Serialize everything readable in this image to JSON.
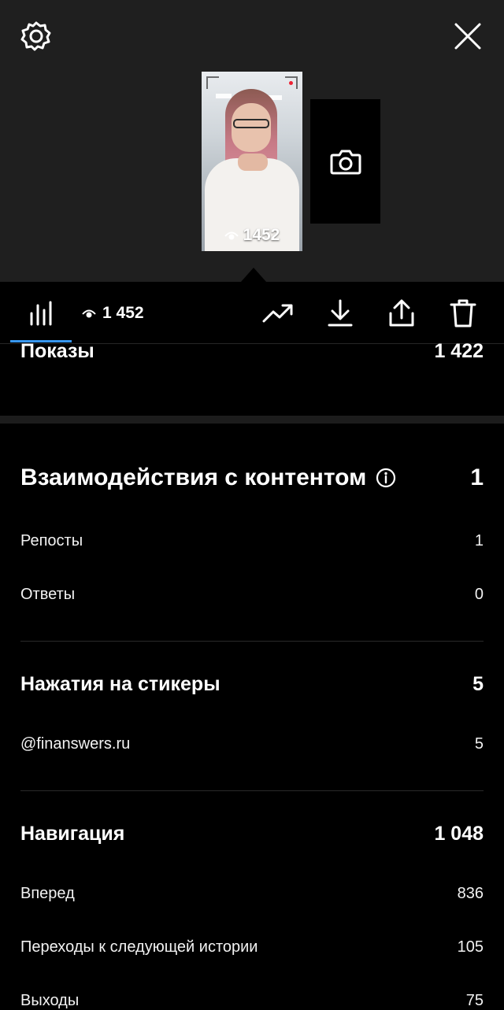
{
  "header": {
    "settings_icon": "settings-outline-icon",
    "close_icon": "close-x-icon"
  },
  "preview": {
    "views_overlay": "1452",
    "camera_icon": "camera-icon"
  },
  "toolbar": {
    "views": "1 452",
    "accent_color": "#3797f0",
    "icons": [
      "bar-chart-icon",
      "eye-icon",
      "trending-up-icon",
      "download-icon",
      "share-icon",
      "trash-icon"
    ]
  },
  "stats": {
    "impressions": {
      "label": "Показы",
      "value": "1 422"
    },
    "interactions": {
      "label": "Взаимодействия с контентом",
      "value": "1",
      "items": [
        {
          "label": "Репосты",
          "value": "1"
        },
        {
          "label": "Ответы",
          "value": "0"
        }
      ]
    },
    "sticker_taps": {
      "label": "Нажатия на стикеры",
      "value": "5",
      "items": [
        {
          "label": "@finanswers.ru",
          "value": "5"
        }
      ]
    },
    "navigation": {
      "label": "Навигация",
      "value": "1 048",
      "items": [
        {
          "label": "Вперед",
          "value": "836"
        },
        {
          "label": "Переходы к следующей истории",
          "value": "105"
        },
        {
          "label": "Выходы",
          "value": "75"
        }
      ]
    }
  }
}
